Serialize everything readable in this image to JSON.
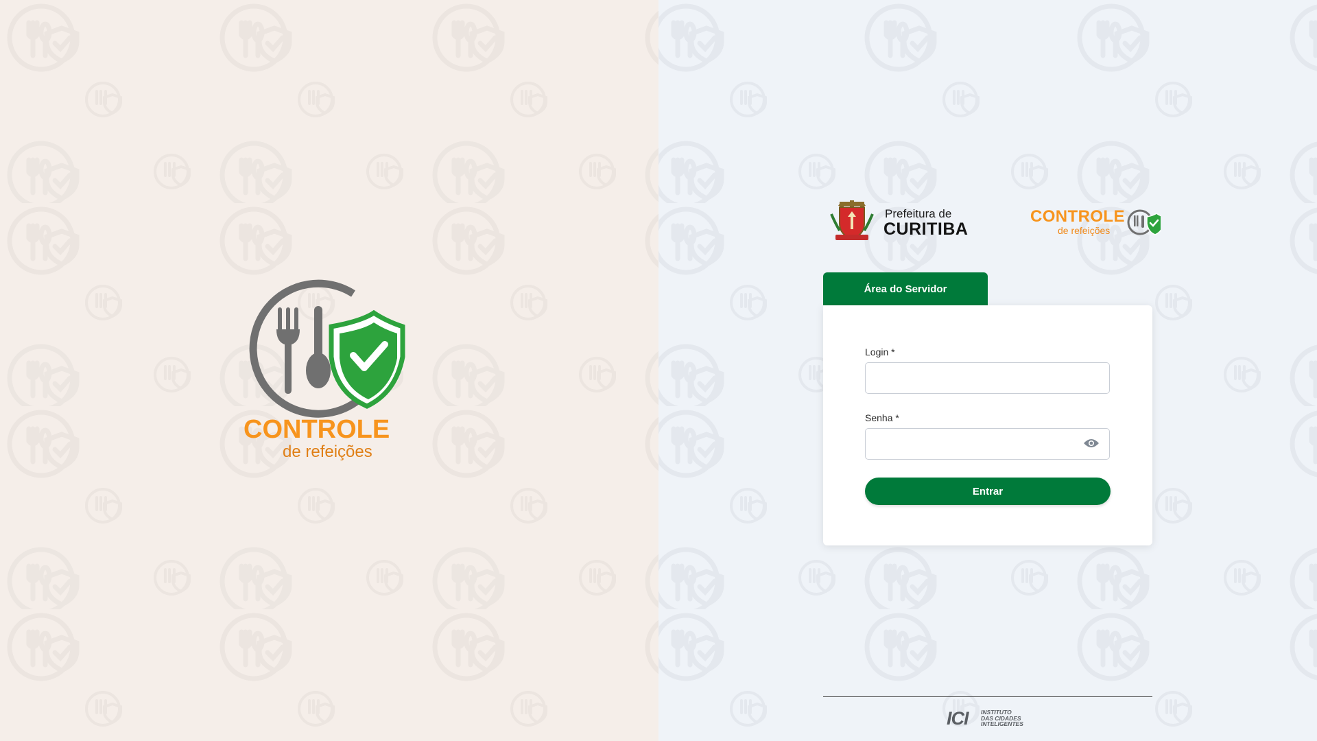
{
  "brand": {
    "title": "CONTROLE",
    "subtitle": "de refeições",
    "title_color": "#f7941d",
    "icon_gray": "#707070",
    "shield_green": "#2da33d"
  },
  "header": {
    "prefeitura_line1": "Prefeitura de",
    "prefeitura_line2": "CURITIBA"
  },
  "tab": {
    "label": "Área do Servidor"
  },
  "form": {
    "login_label": "Login *",
    "login_value": "",
    "password_label": "Senha *",
    "password_value": "",
    "submit_label": "Entrar",
    "password_icon": "eye-icon"
  },
  "footer": {
    "mark": "ICI",
    "line1": "INSTITUTO",
    "line2": "DAS CIDADES",
    "line3": "INTELIGENTES"
  },
  "colors": {
    "primary_green": "#007a3a",
    "left_bg": "#f5eee9",
    "right_bg": "#eff3f8",
    "accent_orange": "#f7941d"
  }
}
